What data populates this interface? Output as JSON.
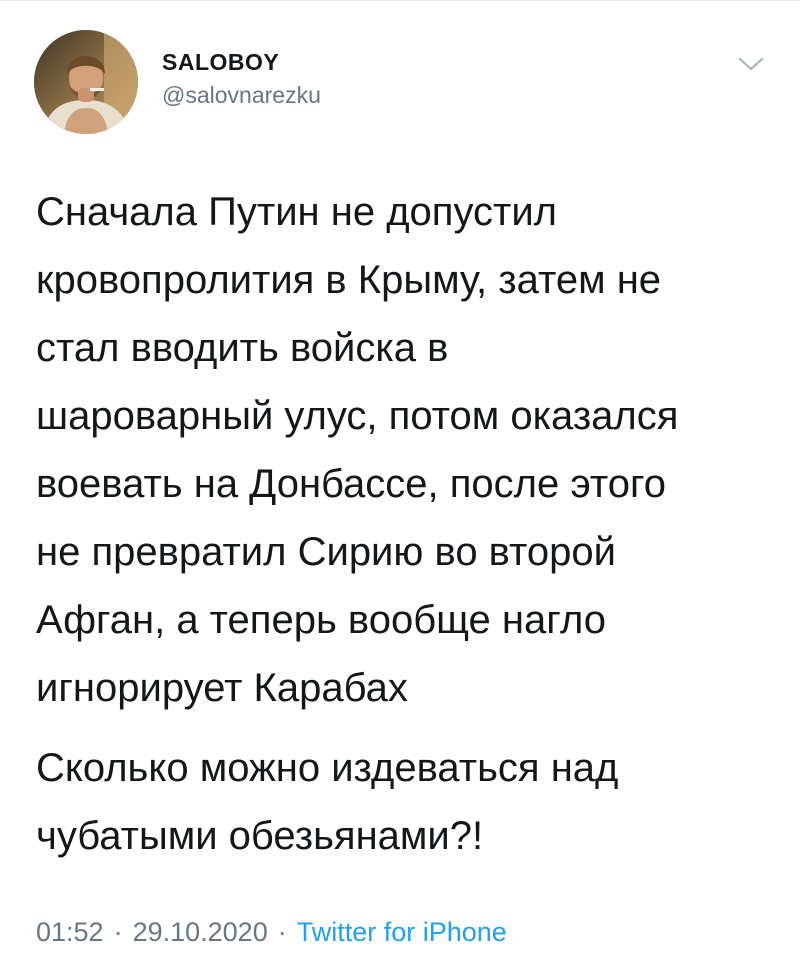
{
  "tweet": {
    "author": {
      "display_name": "SALOBOY",
      "handle": "@salovnarezku"
    },
    "text_paragraphs": [
      "Сначала Путин не допустил\nкровопролития в Крыму, затем не\nстал вводить войска в\nшароварный улус, потом оказался\nвоевать на Донбассе, после этого\nне превратил Сирию во второй\nАфган, а теперь вообще нагло\nигнорирует Карабах",
      "Сколько можно издеваться над\nчубатыми обезьянами?!"
    ],
    "meta": {
      "time": "01:52",
      "separator": "·",
      "date": "29.10.2020",
      "source": "Twitter for iPhone"
    }
  },
  "icons": {
    "menu": "chevron-down-icon"
  },
  "colors": {
    "text": "#14171a",
    "secondary": "#657786",
    "link": "#1da1f2",
    "divider": "#e6ecf0"
  }
}
